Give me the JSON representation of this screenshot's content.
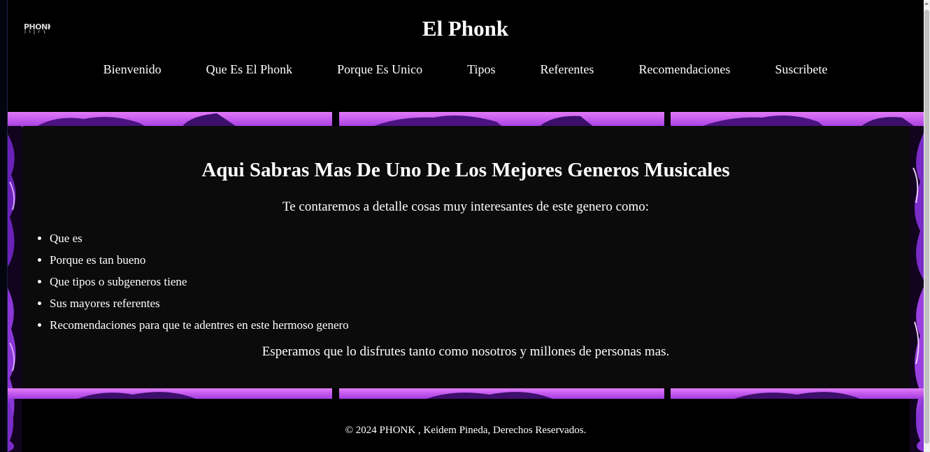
{
  "header": {
    "logo_text": "PHONK",
    "title": "El Phonk",
    "nav": [
      {
        "label": "Bienvenido"
      },
      {
        "label": "Que Es El Phonk"
      },
      {
        "label": "Porque Es Unico"
      },
      {
        "label": "Tipos"
      },
      {
        "label": "Referentes"
      },
      {
        "label": "Recomendaciones"
      },
      {
        "label": "Suscribete"
      }
    ]
  },
  "main": {
    "heading": "Aqui Sabras Mas De Uno De Los Mejores Generos Musicales",
    "intro": "Te contaremos a detalle cosas muy interesantes de este genero como:",
    "list": [
      "Que es",
      "Porque es tan bueno",
      "Que tipos o subgeneros tiene",
      "Sus mayores referentes",
      "Recomendaciones para que te adentres en este hermoso genero"
    ],
    "outro": "Esperamos que lo disfrutes tanto como nosotros y millones de personas mas."
  },
  "footer": {
    "copyright": "© 2024 PHONK , Keidem Pineda, Derechos Reservados."
  },
  "colors": {
    "background": "#000000",
    "card": "#0b0b0b",
    "accent_purple": "#c04cf0",
    "accent_magenta": "#e070ff",
    "text": "#ffffff"
  }
}
